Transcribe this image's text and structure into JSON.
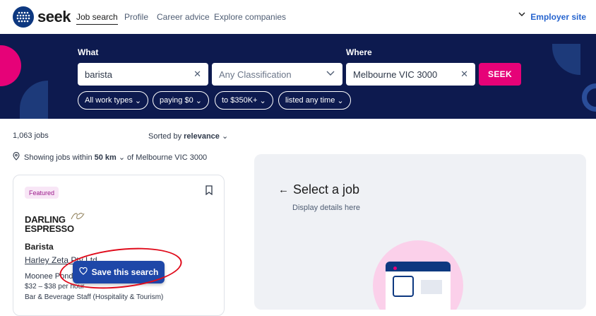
{
  "nav": {
    "logo_text": "seek",
    "links": [
      "Job search",
      "Profile",
      "Career advice",
      "Explore companies"
    ],
    "employer_site": "Employer site"
  },
  "search": {
    "what_label": "What",
    "where_label": "Where",
    "what_value": "barista",
    "classification_placeholder": "Any Classification",
    "where_value": "Melbourne VIC 3000",
    "seek_button": "SEEK",
    "filters": [
      "All work types",
      "paying $0",
      "to $350K+",
      "listed any time"
    ]
  },
  "results": {
    "count": "1,063 jobs",
    "sort_prefix": "Sorted by",
    "sort_value": "relevance",
    "showing_prefix": "Showing jobs within",
    "radius": "50 km",
    "showing_suffix": "of Melbourne VIC 3000"
  },
  "job": {
    "badge": "Featured",
    "brand_line1": "DARLING",
    "brand_line2": "ESPRESSO",
    "title": "Barista",
    "company": "Harley Zeta Pty Ltd",
    "location": "Moonee Ponds",
    "pay": "$32 – $38 per hour",
    "category": "Bar & Beverage Staff (Hospitality & Tourism)"
  },
  "save_search": {
    "label": "Save this search"
  },
  "detail": {
    "heading": "Select a job",
    "subtext": "Display details here"
  },
  "colors": {
    "brand_navy": "#0d1a4f",
    "seek_pink": "#e60278",
    "save_blue": "#1e47a8",
    "highlight_red": "#e00b1b"
  }
}
